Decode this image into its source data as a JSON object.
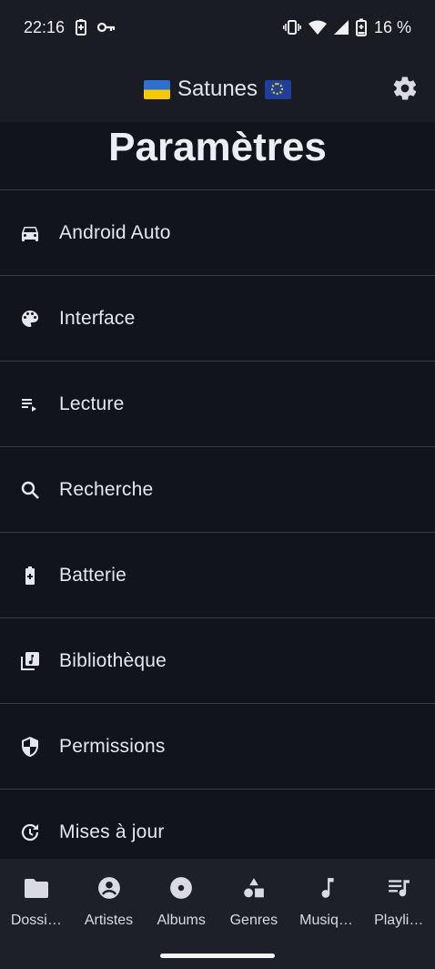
{
  "status_bar": {
    "time": "22:16",
    "battery_percent": "16 %",
    "icons": [
      "battery-saver-icon",
      "key-icon",
      "vibrate-icon",
      "wifi-icon",
      "signal-icon",
      "battery-icon"
    ]
  },
  "app_bar": {
    "app_name": "Satunes",
    "left_flag": "ukraine-flag",
    "right_flag": "eu-flag",
    "settings_icon": "gear-icon"
  },
  "page": {
    "title": "Paramètres"
  },
  "settings_list": [
    {
      "label": "Android Auto",
      "icon": "car-icon"
    },
    {
      "label": "Interface",
      "icon": "palette-icon"
    },
    {
      "label": "Lecture",
      "icon": "playlist-play-icon"
    },
    {
      "label": "Recherche",
      "icon": "search-icon"
    },
    {
      "label": "Batterie",
      "icon": "battery-charging-icon"
    },
    {
      "label": "Bibliothèque",
      "icon": "library-music-icon"
    },
    {
      "label": "Permissions",
      "icon": "shield-icon"
    },
    {
      "label": "Mises à jour",
      "icon": "update-icon"
    }
  ],
  "bottom_nav": [
    {
      "label": "Dossi…",
      "icon": "folder-icon"
    },
    {
      "label": "Artistes",
      "icon": "account-circle-icon"
    },
    {
      "label": "Albums",
      "icon": "album-icon"
    },
    {
      "label": "Genres",
      "icon": "category-icon"
    },
    {
      "label": "Musiq…",
      "icon": "music-note-icon"
    },
    {
      "label": "Playli…",
      "icon": "queue-music-icon"
    }
  ],
  "colors": {
    "background": "#12141c",
    "bars": "#1a1c24",
    "nav_background": "#1e2029",
    "text": "#e6e7ee",
    "divider": "#3a3c45"
  }
}
